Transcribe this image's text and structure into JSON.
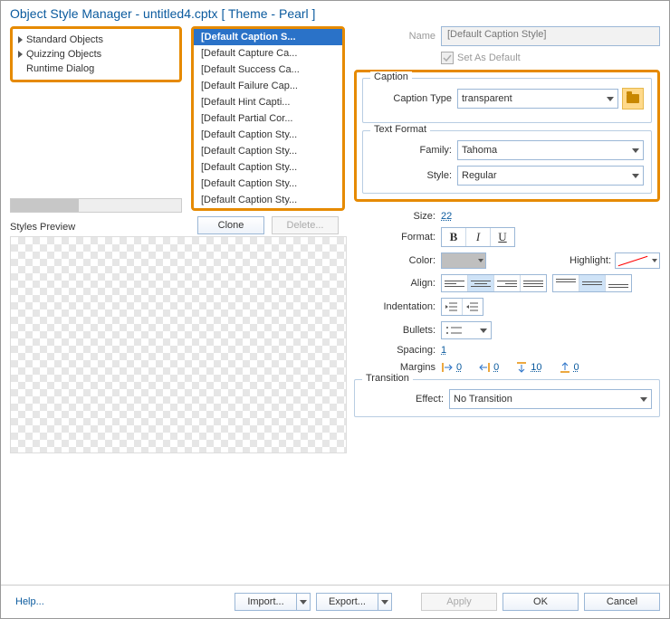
{
  "window": {
    "title": "Object Style Manager - untitled4.cptx [ Theme - Pearl ]"
  },
  "tree": [
    "Standard Objects",
    "Quizzing Objects",
    "Runtime Dialog"
  ],
  "styles": [
    "[Default Caption S...",
    "[Default Capture Ca...",
    "[Default Success Ca...",
    "[Default Failure Cap...",
    "[Default Hint Capti...",
    "[Default Partial Cor...",
    "[Default Caption Sty...",
    "[Default Caption Sty...",
    "[Default Caption Sty...",
    "[Default Caption Sty...",
    "[Default Caption Sty..."
  ],
  "buttons": {
    "clone": "Clone",
    "delete": "Delete..."
  },
  "props": {
    "name_label": "Name",
    "name_value": "[Default Caption Style]",
    "set_default": "Set As Default"
  },
  "caption": {
    "legend": "Caption",
    "type_label": "Caption Type",
    "type_value": "transparent"
  },
  "text": {
    "legend": "Text Format",
    "family_label": "Family:",
    "family_value": "Tahoma",
    "style_label": "Style:",
    "style_value": "Regular",
    "size_label": "Size:",
    "size_value": "22",
    "format_label": "Format:",
    "color_label": "Color:",
    "highlight_label": "Highlight:",
    "align_label": "Align:",
    "indent_label": "Indentation:",
    "bullets_label": "Bullets:",
    "spacing_label": "Spacing:",
    "spacing_value": "1",
    "margins_label": "Margins",
    "margins": {
      "left": "0",
      "right": "0",
      "top": "10",
      "bottom": "0"
    }
  },
  "transition": {
    "legend": "Transition",
    "effect_label": "Effect:",
    "effect_value": "No Transition"
  },
  "preview": {
    "label": "Styles Preview"
  },
  "footer": {
    "help": "Help...",
    "import": "Import...",
    "export": "Export...",
    "apply": "Apply",
    "ok": "OK",
    "cancel": "Cancel"
  }
}
